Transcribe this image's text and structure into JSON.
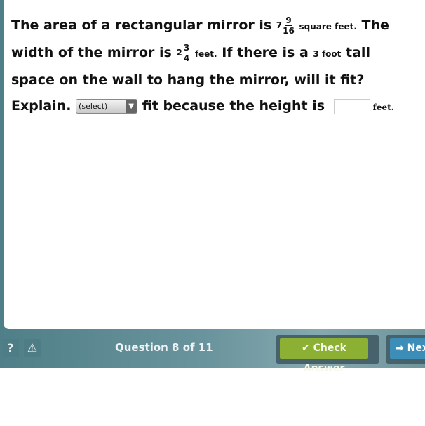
{
  "question": {
    "t1": "The area of a rectangular mirror is ",
    "area_whole": "7",
    "area_num": "9",
    "area_den": "16",
    "area_unit": "square feet.",
    "t2": " The width of the mirror is ",
    "width_whole": "2",
    "width_num": "3",
    "width_den": "4",
    "width_unit": "feet.",
    "t3": " If there is a ",
    "space": "3 foot",
    "t4": " tall space on the wall to hang the mirror, will it fit? Explain. ",
    "select_value": "(select)",
    "t5": " fit because the height is ",
    "height_value": "",
    "height_unit": "feet."
  },
  "footer": {
    "help_icon": "?",
    "warning_icon": "⚠",
    "question_count": "Question 8 of 11",
    "check_label": "Check Answer",
    "next_label": "Next"
  },
  "colors": {
    "check": "#8cb033",
    "next": "#3c8db8",
    "frame": "#5f8b94"
  }
}
